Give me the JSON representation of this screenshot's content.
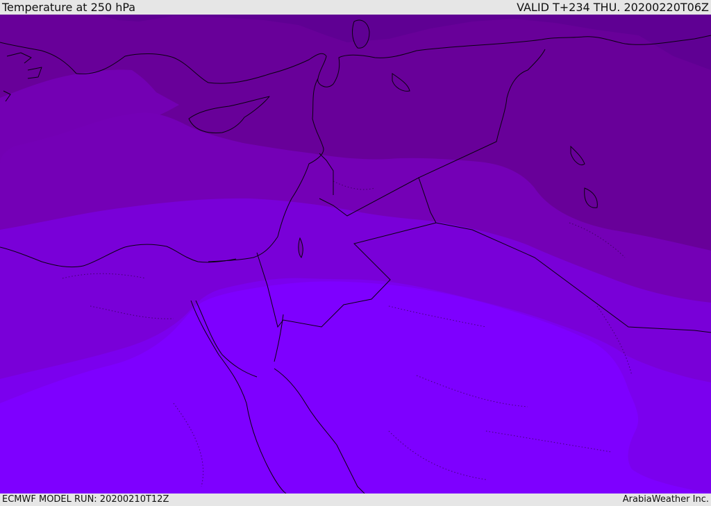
{
  "header": {
    "title": "Temperature at 250 hPa",
    "valid_time": "VALID T+234 THU. 20200220T06Z"
  },
  "footer": {
    "model_run": "ECMWF MODEL RUN: 20200210T12Z",
    "credit": "ArabiaWeather Inc."
  },
  "map": {
    "parameter": "temperature",
    "level": "250 hPa",
    "region": "Eastern Mediterranean / Middle East",
    "colors": {
      "band_darkest": "#5f0093",
      "band_dark": "#680099",
      "band_mid": "#7400b6",
      "band_light": "#7900d8",
      "band_lighter": "#7b00ee",
      "band_brightest": "#7e00ff",
      "coastline": "#0a0010"
    }
  }
}
